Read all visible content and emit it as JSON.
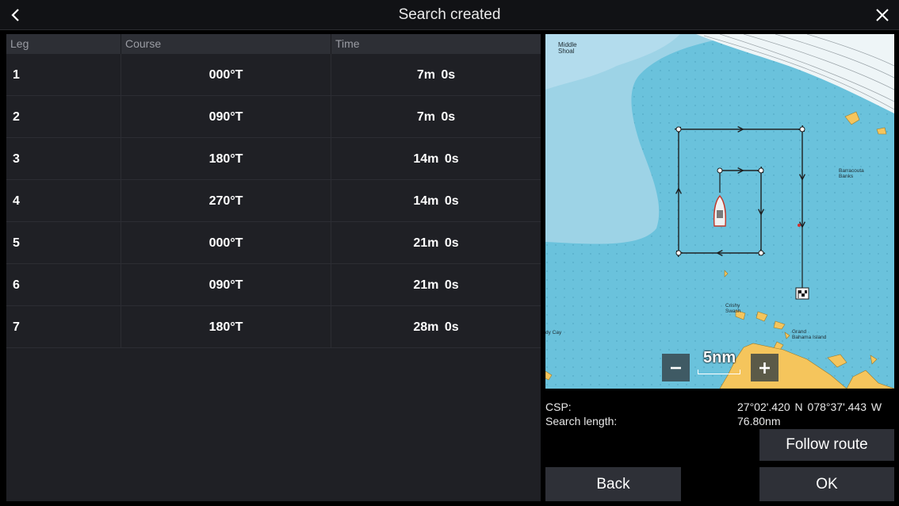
{
  "header": {
    "title": "Search created",
    "back_icon": "chevron-left-icon",
    "close_icon": "close-icon"
  },
  "table": {
    "columns": [
      "Leg",
      "Course",
      "Time"
    ],
    "rows": [
      {
        "leg": "1",
        "course": "000°T",
        "time": "7m 0s"
      },
      {
        "leg": "2",
        "course": "090°T",
        "time": "7m 0s"
      },
      {
        "leg": "3",
        "course": "180°T",
        "time": "14m 0s"
      },
      {
        "leg": "4",
        "course": "270°T",
        "time": "14m 0s"
      },
      {
        "leg": "5",
        "course": "000°T",
        "time": "21m 0s"
      },
      {
        "leg": "6",
        "course": "090°T",
        "time": "21m 0s"
      },
      {
        "leg": "7",
        "course": "180°T",
        "time": "28m 0s"
      }
    ]
  },
  "map": {
    "labels": {
      "middle_shoal_1": "Middle",
      "middle_shoal_2": "Shoal",
      "barracouta_1": "Barracouta",
      "barracouta_2": "Banks",
      "crishy_1": "Crishy",
      "crishy_2": "Swash",
      "grand_1": "Grand",
      "grand_2": "Bahama Island",
      "cay": "dy Cay"
    },
    "scale_label": "5nm",
    "zoom_in_icon": "plus-icon",
    "zoom_out_icon": "minus-icon",
    "vessel_icon": "boat-icon",
    "finish_icon": "checkered-flag-icon",
    "colors": {
      "deep": "#6ac2dc",
      "shallow": "#9dd3e6",
      "land": "#f5c55c",
      "route": "#1c1c1c"
    }
  },
  "info": {
    "csp_label": "CSP:",
    "csp_value": "27°02'.420 N   078°37'.443 W",
    "length_label": "Search length:",
    "length_value": "76.80nm"
  },
  "buttons": {
    "follow_route": "Follow route",
    "back": "Back",
    "ok": "OK"
  }
}
